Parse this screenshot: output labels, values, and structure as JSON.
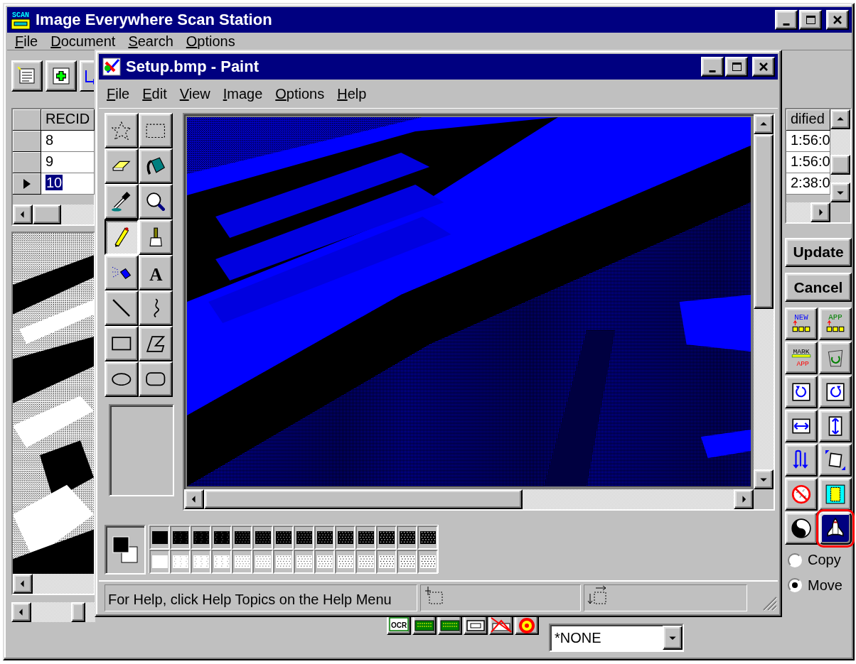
{
  "main_window": {
    "title": "Image Everywhere Scan Station",
    "logo_text": "SCAN",
    "menu": [
      "File",
      "Document",
      "Search",
      "Options"
    ],
    "record_grid": {
      "columns": [
        "RECID"
      ],
      "rows": [
        {
          "cells": [
            "8"
          ],
          "selected": false
        },
        {
          "cells": [
            "9"
          ],
          "selected": false
        },
        {
          "cells": [
            "10"
          ],
          "selected": true
        }
      ]
    },
    "modified_grid": {
      "columns": [
        "dified"
      ],
      "rows": [
        {
          "cells": [
            "1:56:0"
          ]
        },
        {
          "cells": [
            "1:56:0"
          ]
        },
        {
          "cells": [
            "2:38:0"
          ]
        }
      ]
    },
    "actions": [
      "Update",
      "Cancel"
    ],
    "tool_buttons": [
      {
        "kind": "new",
        "label": "NEW",
        "highlighted": false
      },
      {
        "kind": "append",
        "label": "APP",
        "highlighted": false
      },
      {
        "kind": "mark",
        "label": "MARK",
        "sublabel": "APP",
        "highlighted": false
      },
      {
        "kind": "recycle",
        "highlighted": false
      },
      {
        "kind": "rotate-left",
        "highlighted": false
      },
      {
        "kind": "rotate-right",
        "highlighted": false
      },
      {
        "kind": "fit-width",
        "highlighted": false
      },
      {
        "kind": "fit-height",
        "highlighted": false
      },
      {
        "kind": "flip",
        "highlighted": false
      },
      {
        "kind": "skew",
        "highlighted": false
      },
      {
        "kind": "despeckle",
        "highlighted": false
      },
      {
        "kind": "crop",
        "highlighted": false
      },
      {
        "kind": "yin-yang",
        "highlighted": false
      },
      {
        "kind": "shuttle",
        "highlighted": true
      }
    ],
    "transfer_mode": [
      {
        "label": "Copy",
        "selected": false
      },
      {
        "label": "Move",
        "selected": true
      }
    ],
    "bottom_tools": [
      {
        "kind": "ocr",
        "label": "OCR"
      },
      {
        "kind": "scan"
      },
      {
        "kind": "scan"
      },
      {
        "kind": "scanner"
      },
      {
        "kind": "no-scan"
      },
      {
        "kind": "target"
      }
    ],
    "document_type": {
      "value": "*NONE"
    }
  },
  "paint_window": {
    "title": "Setup.bmp - Paint",
    "menu": [
      "File",
      "Edit",
      "View",
      "Image",
      "Options",
      "Help"
    ],
    "tools": [
      {
        "kind": "free-select",
        "selected": false
      },
      {
        "kind": "select",
        "selected": false
      },
      {
        "kind": "eraser",
        "selected": false
      },
      {
        "kind": "fill",
        "selected": false
      },
      {
        "kind": "picker",
        "selected": false
      },
      {
        "kind": "magnifier",
        "selected": false
      },
      {
        "kind": "pencil",
        "selected": true
      },
      {
        "kind": "brush",
        "selected": false
      },
      {
        "kind": "airbrush",
        "selected": false
      },
      {
        "kind": "text",
        "label": "A",
        "selected": false
      },
      {
        "kind": "line",
        "selected": false
      },
      {
        "kind": "curve",
        "selected": false
      },
      {
        "kind": "rectangle",
        "selected": false
      },
      {
        "kind": "polygon",
        "selected": false
      },
      {
        "kind": "ellipse",
        "selected": false
      },
      {
        "kind": "rounded-rectangle",
        "selected": false
      }
    ],
    "status_bar": {
      "text": "For Help, click Help Topics on the Help Menu"
    }
  }
}
